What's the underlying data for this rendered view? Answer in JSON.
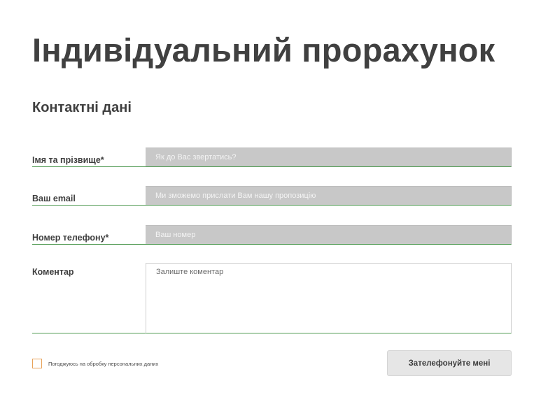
{
  "header": {
    "title": "Індивідуальний прорахунок"
  },
  "contacts": {
    "section_title": "Контактні дані",
    "fields": {
      "name": {
        "label": "Імя та прізвище*",
        "placeholder": "Як до Вас звертатись?"
      },
      "email": {
        "label": "Ваш email",
        "placeholder": "Ми зможемо прислати Вам нашу пропозицію"
      },
      "phone": {
        "label": "Номер телефону*",
        "placeholder": "Ваш номер"
      },
      "comment": {
        "label": "Коментар",
        "placeholder": "Залиште коментар"
      }
    }
  },
  "consent": {
    "label": "Погоджуюсь на обробку персональних даних",
    "checked": false
  },
  "submit": {
    "label": "Зателефонуйте мені"
  },
  "colors": {
    "accent_underline": "#4f9a52",
    "checkbox_border": "#e8a35a",
    "field_background": "#c8c8c8"
  }
}
